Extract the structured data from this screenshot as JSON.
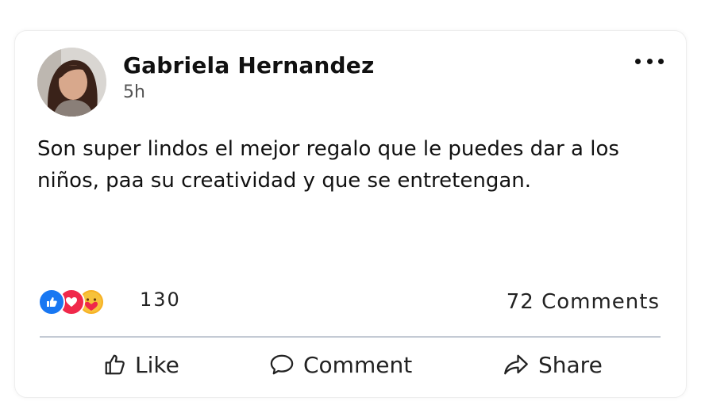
{
  "post": {
    "author": "Gabriela Hernandez",
    "time": "5h",
    "text": "Son super lindos el mejor regalo que le puedes dar a los niños, paa su creatividad y que se entretengan.",
    "reactions": {
      "icons": [
        "like-icon",
        "love-icon",
        "care-icon"
      ],
      "count": "130"
    },
    "comments_label": "72 Comments",
    "actions": {
      "like": "Like",
      "comment": "Comment",
      "share": "Share"
    }
  },
  "colors": {
    "like": "#1877f2",
    "love": "#f0284a",
    "care": "#f7b125",
    "divider": "#c4cad4"
  }
}
